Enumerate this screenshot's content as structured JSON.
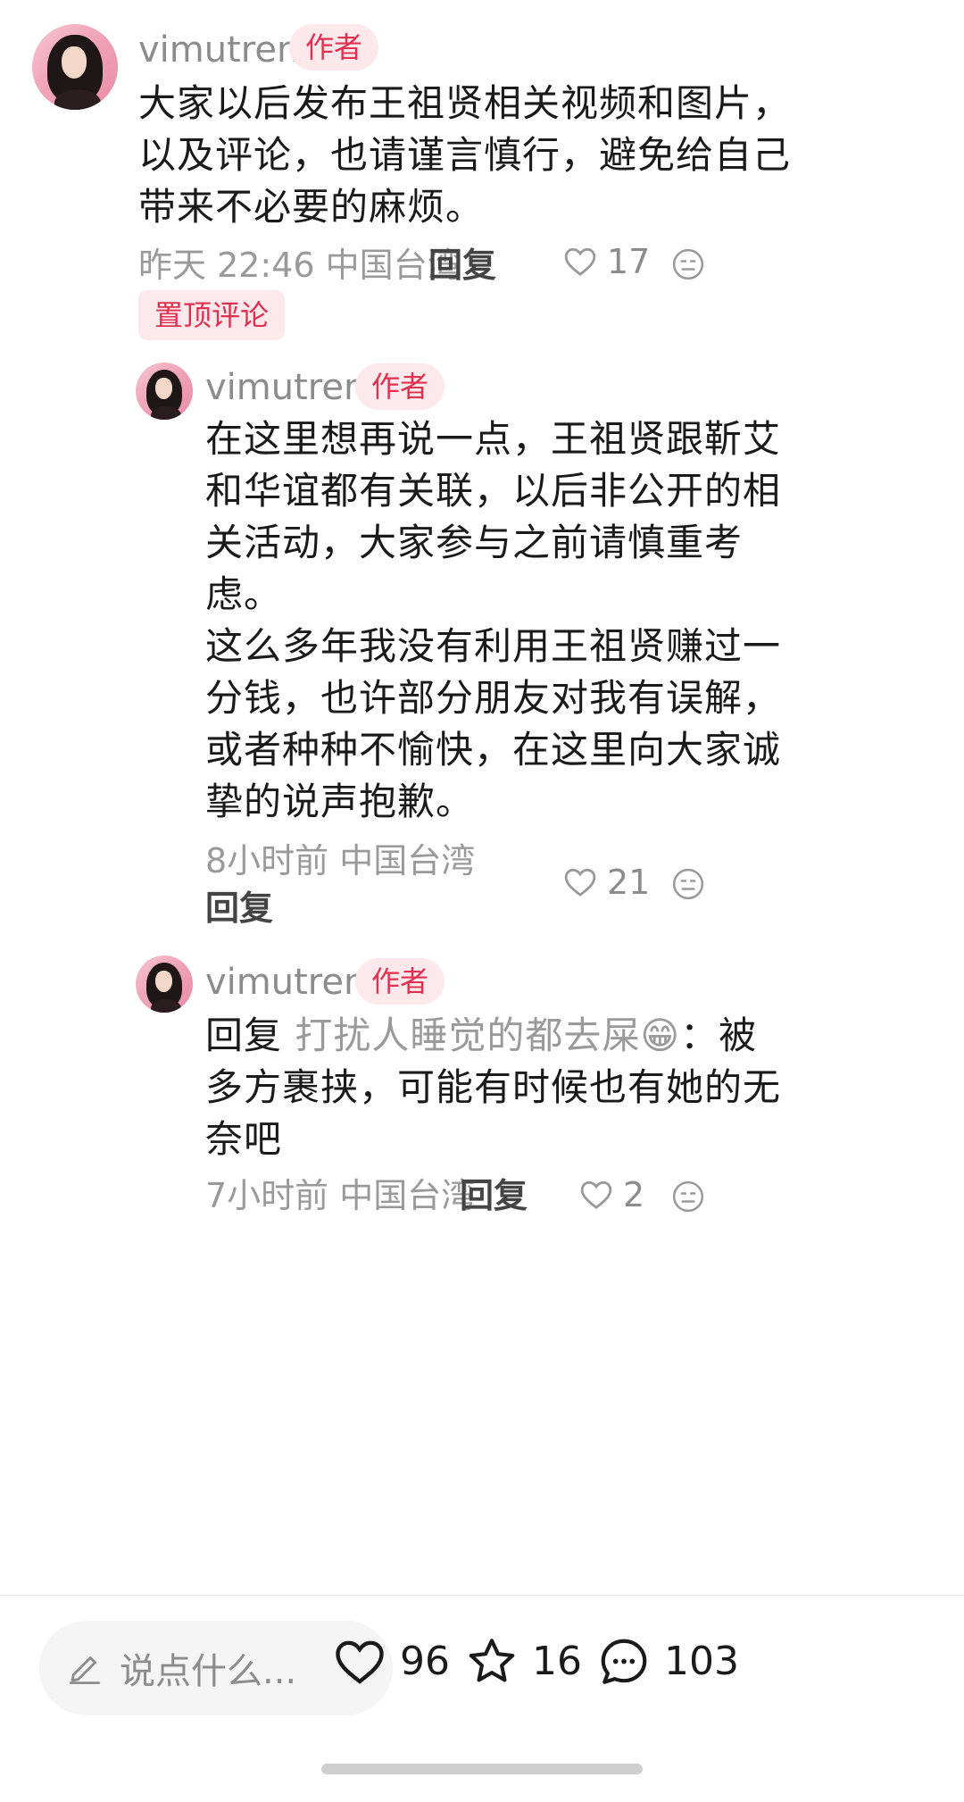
{
  "comments": [
    {
      "username": "vimutrent",
      "badge": "作者",
      "text": "大家以后发布王祖贤相关视频和图片，\n以及评论，也请谨言慎行，避免给自己\n带来不必要的麻烦。",
      "time": "昨天 22:46 中国台湾",
      "reply": "回复",
      "likes": "17",
      "pinned": "置顶评论"
    },
    {
      "username": "vimutrent",
      "badge": "作者",
      "text": "在这里想再说一点，王祖贤跟靳艾\n和华谊都有关联，以后非公开的相\n关活动，大家参与之前请慎重考\n虑。\n这么多年我没有利用王祖贤赚过一\n分钱，也许部分朋友对我有误解，\n或者种种不愉快，在这里向大家诚\n挚的说声抱歉。",
      "time": "8小时前 中国台湾",
      "reply": "回复",
      "likes": "21"
    },
    {
      "username": "vimutrent",
      "badge": "作者",
      "reply_prefix": "回复",
      "mention": "打扰人睡觉的都去屎😁",
      "text_line1_rest": "：被",
      "text_rest": "多方裹挟，可能有时候也有她的无\n奈吧",
      "time": "7小时前 中国台湾",
      "reply": "回复",
      "likes": "2"
    }
  ],
  "bottom_bar": {
    "input_placeholder": "说点什么...",
    "likes": "96",
    "favorites": "16",
    "comments": "103"
  },
  "colors": {
    "accent": "#e0304f",
    "badge_bg": "#fde8ec",
    "muted_text": "#9a9a9a"
  },
  "icons": [
    "edit-pen-icon",
    "heart-icon",
    "star-icon",
    "comment-bubble-icon",
    "meh-face-icon"
  ]
}
